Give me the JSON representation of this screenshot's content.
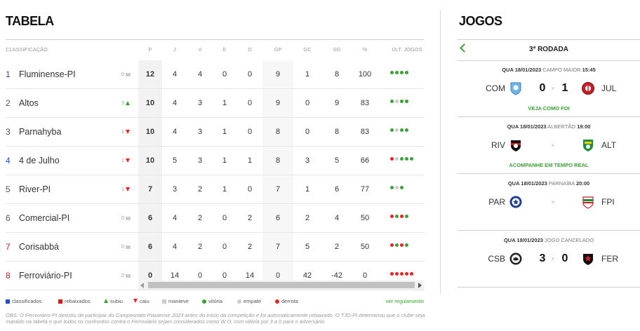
{
  "tabela": {
    "title": "TABELA",
    "headers": {
      "classificacao": "CLASSIFICAÇÃO",
      "p": "P",
      "j": "J",
      "v": "V",
      "e": "E",
      "d": "D",
      "gp": "GP",
      "gc": "GC",
      "sg": "SG",
      "pct": "%",
      "ult": "ÚLT. JOGOS"
    },
    "rows": [
      {
        "pos": "1",
        "team": "Fluminense-PI",
        "var": "0",
        "trend": "same",
        "p": "12",
        "j": "4",
        "v": "4",
        "e": "0",
        "d": "0",
        "gp": "9",
        "gc": "1",
        "sg": "8",
        "pct": "100",
        "last": [
          "v",
          "v",
          "v",
          "v"
        ],
        "pos_color": "blue"
      },
      {
        "pos": "2",
        "team": "Altos",
        "var": "3",
        "trend": "up",
        "p": "10",
        "j": "4",
        "v": "3",
        "e": "1",
        "d": "0",
        "gp": "9",
        "gc": "0",
        "sg": "9",
        "pct": "83",
        "last": [
          "v",
          "e",
          "v",
          "v"
        ],
        "pos_color": "gray"
      },
      {
        "pos": "3",
        "team": "Parnahyba",
        "var": "1",
        "trend": "down",
        "p": "10",
        "j": "4",
        "v": "3",
        "e": "1",
        "d": "0",
        "gp": "8",
        "gc": "0",
        "sg": "8",
        "pct": "83",
        "last": [
          "v",
          "e",
          "v",
          "v"
        ],
        "pos_color": "gray"
      },
      {
        "pos": "4",
        "team": "4 de Julho",
        "var": "1",
        "trend": "down",
        "p": "10",
        "j": "5",
        "v": "3",
        "e": "1",
        "d": "1",
        "gp": "8",
        "gc": "3",
        "sg": "5",
        "pct": "66",
        "last": [
          "d",
          "e",
          "v",
          "v",
          "v"
        ],
        "pos_color": "blue"
      },
      {
        "pos": "5",
        "team": "River-PI",
        "var": "1",
        "trend": "down",
        "p": "7",
        "j": "3",
        "v": "2",
        "e": "1",
        "d": "0",
        "gp": "7",
        "gc": "1",
        "sg": "6",
        "pct": "77",
        "last": [
          "v",
          "e",
          "v"
        ],
        "pos_color": "gray"
      },
      {
        "pos": "6",
        "team": "Comercial-PI",
        "var": "0",
        "trend": "same",
        "p": "6",
        "j": "4",
        "v": "2",
        "e": "0",
        "d": "2",
        "gp": "6",
        "gc": "2",
        "sg": "4",
        "pct": "50",
        "last": [
          "d",
          "v",
          "d",
          "v"
        ],
        "pos_color": "gray"
      },
      {
        "pos": "7",
        "team": "Corisabbá",
        "var": "0",
        "trend": "same",
        "p": "6",
        "j": "4",
        "v": "2",
        "e": "0",
        "d": "2",
        "gp": "7",
        "gc": "5",
        "sg": "2",
        "pct": "50",
        "last": [
          "d",
          "v",
          "d",
          "v"
        ],
        "pos_color": "red"
      },
      {
        "pos": "8",
        "team": "Ferroviário-PI",
        "var": "0",
        "trend": "same",
        "p": "0",
        "j": "14",
        "v": "0",
        "e": "0",
        "d": "14",
        "gp": "0",
        "gc": "42",
        "sg": "-42",
        "pct": "0",
        "last": [
          "d",
          "d",
          "d",
          "d",
          "d"
        ],
        "pos_color": "red"
      }
    ],
    "legend": {
      "classificados": "classificados",
      "rebaixados": "rebaixados",
      "subiu": "subiu",
      "caiu": "caiu",
      "manteve": "manteve",
      "vitoria": "vitória",
      "empate": "empate",
      "derrota": "derrota",
      "regulamento": "ver regulamento"
    },
    "obs": "OBS: O Ferroviário-PI desistiu de participar do Campeonato Piauiense 2023 antes do início da competição e foi automaticamente rebaixado. O TJD-PI determinou que o clube seja mantido na tabela e que todos os confrontos contra o Ferroviário sejam considerados como W.O, com vitória por 3 a 0 para o adversário."
  },
  "jogos": {
    "title": "JOGOS",
    "rodada": "3ª RODADA",
    "matches": [
      {
        "day": "QUA 18/01/2023",
        "venue": "CAMPO MAIOR",
        "time": "15:45",
        "home": "COM",
        "away": "JUL",
        "home_score": "0",
        "away_score": "1",
        "sep": "×",
        "link": "VEJA COMO FOI"
      },
      {
        "day": "QUA 18/01/2023",
        "venue": "ALBERTÃO",
        "time": "19:00",
        "home": "RIV",
        "away": "ALT",
        "home_score": "",
        "away_score": "",
        "sep": "×",
        "link": "ACOMPANHE EM TEMPO REAL"
      },
      {
        "day": "QUA 18/01/2023",
        "venue": "PARNAÍBA",
        "time": "20:00",
        "home": "PAR",
        "away": "FPI",
        "home_score": "",
        "away_score": "",
        "sep": "×",
        "link": ""
      },
      {
        "day": "QUA 18/01/2023",
        "venue": "JOGO CANCELADO",
        "time": "",
        "home": "CSB",
        "away": "FER",
        "home_score": "3",
        "away_score": "0",
        "sep": "×",
        "link": ""
      }
    ]
  },
  "colors": {
    "accent": "#3aa335",
    "loss": "#e22222",
    "draw": "#cccccc",
    "classified": "#1f4bd1",
    "relegated": "#d81818"
  }
}
